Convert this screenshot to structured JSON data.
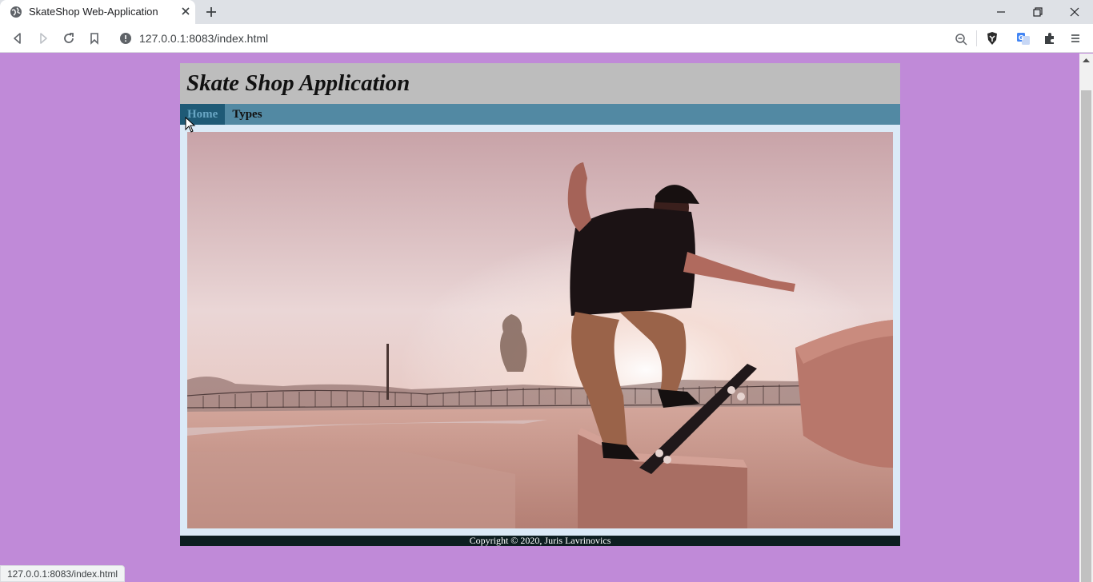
{
  "browser": {
    "tab_title": "SkateShop Web-Application",
    "url": "127.0.0.1:8083/index.html",
    "status_url": "127.0.0.1:8083/index.html"
  },
  "site": {
    "title": "Skate Shop Application",
    "nav": [
      {
        "label": "Home",
        "active": true
      },
      {
        "label": "Types",
        "active": false
      }
    ],
    "hero_alt": "skater",
    "footer": "Copyright © 2020, Juris Lavrinovics"
  },
  "colors": {
    "page_bg": "#c08ad8",
    "header_bg": "#bdbdbd",
    "nav_bg": "#5289a3",
    "nav_active_bg": "#1f5a76",
    "content_bg": "#dbeaf7",
    "footer_bg": "#0d1e21"
  }
}
